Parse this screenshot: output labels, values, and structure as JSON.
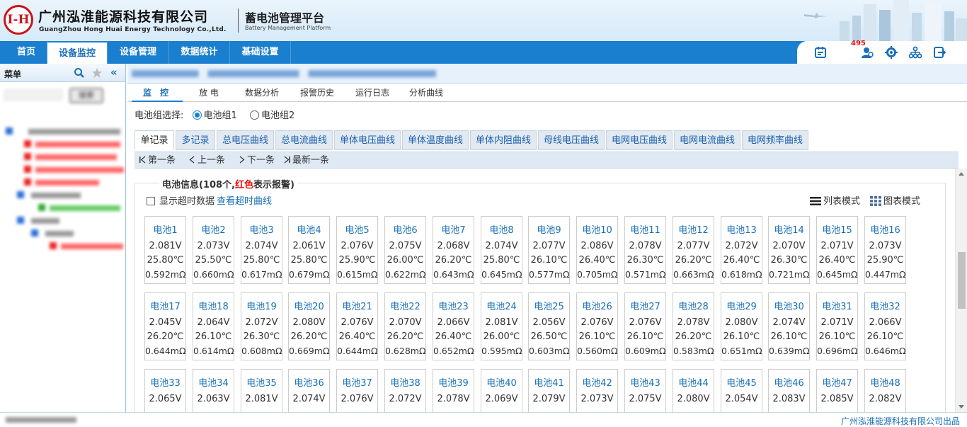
{
  "header": {
    "logo_text": "I-H",
    "company_cn": "广州泓淮能源科技有限公司",
    "company_en": "GuangZhou Hong Huai Energy Technology Co.,Ltd.",
    "platform_cn": "蓄电池管理平台",
    "platform_en": "Battery Management Platform"
  },
  "nav": {
    "items": [
      {
        "label": "首页",
        "active": false
      },
      {
        "label": "设备监控",
        "active": true
      },
      {
        "label": "设备管理",
        "active": false
      },
      {
        "label": "数据统计",
        "active": false
      },
      {
        "label": "基础设置",
        "active": false
      }
    ],
    "alarm_count": "495",
    "tool_icons": [
      "calendar-icon",
      "user-alarm-icon",
      "gear-icon",
      "org-tree-icon",
      "logout-icon"
    ]
  },
  "sidebar": {
    "title": "菜单",
    "search_button": "搜索"
  },
  "tabs": {
    "items": [
      "监 控",
      "放 电",
      "数据分析",
      "报警历史",
      "运行日志",
      "分析曲线"
    ],
    "active": 0
  },
  "group_select": {
    "label": "电池组选择:",
    "options": [
      "电池组1",
      "电池组2"
    ],
    "selected": 0
  },
  "sub_tabs": {
    "items": [
      "单记录",
      "多记录",
      "总电压曲线",
      "总电流曲线",
      "单体电压曲线",
      "单体温度曲线",
      "单体内阻曲线",
      "母线电压曲线",
      "电网电压曲线",
      "电网电流曲线",
      "电网频率曲线"
    ],
    "active": 0
  },
  "pager": {
    "first": "第一条",
    "prev": "上一条",
    "next": "下一条",
    "latest": "最新一条"
  },
  "battery_info": {
    "legend_prefix": "电池信息(108个,",
    "legend_red": "红色",
    "legend_suffix": "表示报警)",
    "show_overtime_label": "显示超时数据",
    "overtime_curve_link": "查看超时曲线",
    "list_mode": "列表模式",
    "chart_mode": "图表模式"
  },
  "cells": [
    {
      "name": "电池1",
      "v": "2.081V",
      "t": "25.80℃",
      "r": "0.592mΩ"
    },
    {
      "name": "电池2",
      "v": "2.073V",
      "t": "25.50℃",
      "r": "0.660mΩ"
    },
    {
      "name": "电池3",
      "v": "2.074V",
      "t": "25.80℃",
      "r": "0.617mΩ"
    },
    {
      "name": "电池4",
      "v": "2.061V",
      "t": "25.80℃",
      "r": "0.679mΩ"
    },
    {
      "name": "电池5",
      "v": "2.076V",
      "t": "25.90℃",
      "r": "0.615mΩ"
    },
    {
      "name": "电池6",
      "v": "2.075V",
      "t": "26.00℃",
      "r": "0.622mΩ"
    },
    {
      "name": "电池7",
      "v": "2.068V",
      "t": "26.20℃",
      "r": "0.643mΩ"
    },
    {
      "name": "电池8",
      "v": "2.074V",
      "t": "25.80℃",
      "r": "0.645mΩ"
    },
    {
      "name": "电池9",
      "v": "2.077V",
      "t": "26.10℃",
      "r": "0.577mΩ"
    },
    {
      "name": "电池10",
      "v": "2.086V",
      "t": "26.40℃",
      "r": "0.705mΩ"
    },
    {
      "name": "电池11",
      "v": "2.078V",
      "t": "26.30℃",
      "r": "0.571mΩ"
    },
    {
      "name": "电池12",
      "v": "2.077V",
      "t": "26.20℃",
      "r": "0.663mΩ"
    },
    {
      "name": "电池13",
      "v": "2.072V",
      "t": "26.40℃",
      "r": "0.618mΩ"
    },
    {
      "name": "电池14",
      "v": "2.070V",
      "t": "26.30℃",
      "r": "0.721mΩ"
    },
    {
      "name": "电池15",
      "v": "2.071V",
      "t": "26.40℃",
      "r": "0.645mΩ"
    },
    {
      "name": "电池16",
      "v": "2.073V",
      "t": "25.90℃",
      "r": "0.447mΩ"
    },
    {
      "name": "电池17",
      "v": "2.045V",
      "t": "26.20℃",
      "r": "0.644mΩ"
    },
    {
      "name": "电池18",
      "v": "2.064V",
      "t": "26.10℃",
      "r": "0.614mΩ"
    },
    {
      "name": "电池19",
      "v": "2.072V",
      "t": "26.30℃",
      "r": "0.608mΩ"
    },
    {
      "name": "电池20",
      "v": "2.080V",
      "t": "26.20℃",
      "r": "0.669mΩ"
    },
    {
      "name": "电池21",
      "v": "2.076V",
      "t": "26.40℃",
      "r": "0.644mΩ"
    },
    {
      "name": "电池22",
      "v": "2.070V",
      "t": "26.20℃",
      "r": "0.628mΩ"
    },
    {
      "name": "电池23",
      "v": "2.066V",
      "t": "26.40℃",
      "r": "0.652mΩ"
    },
    {
      "name": "电池24",
      "v": "2.081V",
      "t": "26.00℃",
      "r": "0.595mΩ"
    },
    {
      "name": "电池25",
      "v": "2.056V",
      "t": "26.50℃",
      "r": "0.603mΩ"
    },
    {
      "name": "电池26",
      "v": "2.076V",
      "t": "26.10℃",
      "r": "0.560mΩ"
    },
    {
      "name": "电池27",
      "v": "2.076V",
      "t": "26.10℃",
      "r": "0.609mΩ"
    },
    {
      "name": "电池28",
      "v": "2.078V",
      "t": "26.20℃",
      "r": "0.583mΩ"
    },
    {
      "name": "电池29",
      "v": "2.080V",
      "t": "26.10℃",
      "r": "0.651mΩ"
    },
    {
      "name": "电池30",
      "v": "2.074V",
      "t": "26.10℃",
      "r": "0.639mΩ"
    },
    {
      "name": "电池31",
      "v": "2.071V",
      "t": "26.10℃",
      "r": "0.696mΩ"
    },
    {
      "name": "电池32",
      "v": "2.066V",
      "t": "26.10℃",
      "r": "0.646mΩ"
    },
    {
      "name": "电池33",
      "v": "2.065V",
      "t": "",
      "r": ""
    },
    {
      "name": "电池34",
      "v": "2.063V",
      "t": "",
      "r": ""
    },
    {
      "name": "电池35",
      "v": "2.081V",
      "t": "",
      "r": ""
    },
    {
      "name": "电池36",
      "v": "2.074V",
      "t": "",
      "r": ""
    },
    {
      "name": "电池37",
      "v": "2.076V",
      "t": "",
      "r": ""
    },
    {
      "name": "电池38",
      "v": "2.072V",
      "t": "",
      "r": ""
    },
    {
      "name": "电池39",
      "v": "2.078V",
      "t": "",
      "r": ""
    },
    {
      "name": "电池40",
      "v": "2.069V",
      "t": "",
      "r": ""
    },
    {
      "name": "电池41",
      "v": "2.079V",
      "t": "",
      "r": ""
    },
    {
      "name": "电池42",
      "v": "2.073V",
      "t": "",
      "r": ""
    },
    {
      "name": "电池43",
      "v": "2.075V",
      "t": "",
      "r": ""
    },
    {
      "name": "电池44",
      "v": "2.080V",
      "t": "",
      "r": ""
    },
    {
      "name": "电池45",
      "v": "2.054V",
      "t": "",
      "r": ""
    },
    {
      "name": "电池46",
      "v": "2.083V",
      "t": "",
      "r": ""
    },
    {
      "name": "电池47",
      "v": "2.085V",
      "t": "",
      "r": ""
    },
    {
      "name": "电池48",
      "v": "2.082V",
      "t": "",
      "r": ""
    }
  ],
  "footer": {
    "company": "广州泓淮能源科技有限公司出品"
  },
  "colors": {
    "nav_blue": "#1a7fcf",
    "link_blue": "#1a6fb8",
    "alarm_red": "#e00000",
    "logo_red": "#c8161d"
  }
}
